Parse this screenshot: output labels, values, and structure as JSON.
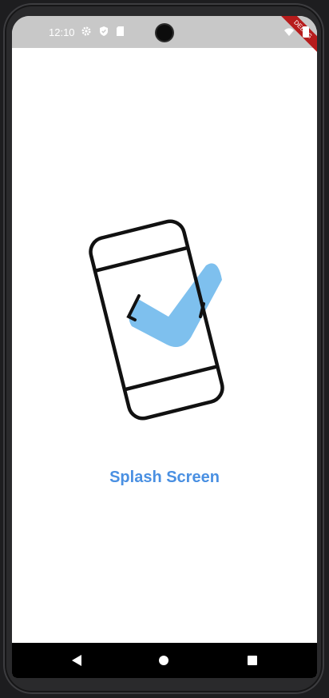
{
  "status_bar": {
    "time": "12:10",
    "icons": [
      "settings-gear-icon",
      "shield-icon",
      "sd-card-icon",
      "wifi-icon",
      "battery-icon"
    ],
    "debug_banner": "DEBUG"
  },
  "main": {
    "illustration": "phone-with-checkmark",
    "title": "Splash Screen"
  },
  "colors": {
    "accent": "#4A90E2",
    "check_fill": "#7EC0EE",
    "status_bar_bg": "#C8C8C8",
    "screen_bg": "#FFFFFF",
    "nav_bar_bg": "#000000",
    "debug_banner": "#B71C1C"
  },
  "nav_bar": {
    "back": "back-triangle-icon",
    "home": "home-circle-icon",
    "recents": "recents-square-icon"
  }
}
